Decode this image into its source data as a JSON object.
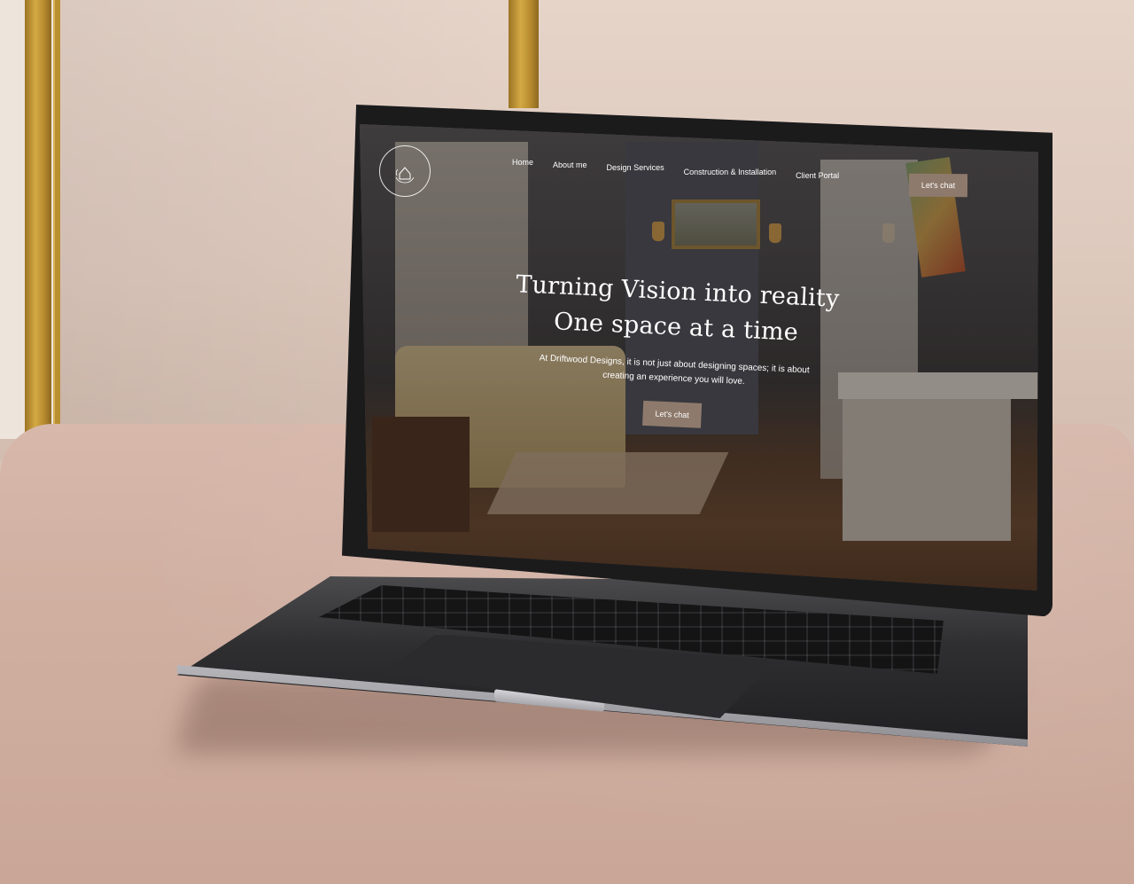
{
  "site": {
    "nav": [
      {
        "label": "Home"
      },
      {
        "label": "About me"
      },
      {
        "label": "Design Services"
      },
      {
        "label": "Construction & Installation"
      },
      {
        "label": "Client Portal"
      }
    ],
    "cta_top": "Let's chat",
    "hero": {
      "title_line1": "Turning Vision into reality",
      "title_line2": "One space at a time",
      "subtitle": "At Driftwood Designs, it is not just about designing spaces; it is about creating an experience you will love.",
      "cta": "Let's chat"
    }
  },
  "colors": {
    "button_bg": "#8e7a6c",
    "text": "#ffffff"
  },
  "icons": {
    "logo": "house-wreath-logo-icon"
  }
}
